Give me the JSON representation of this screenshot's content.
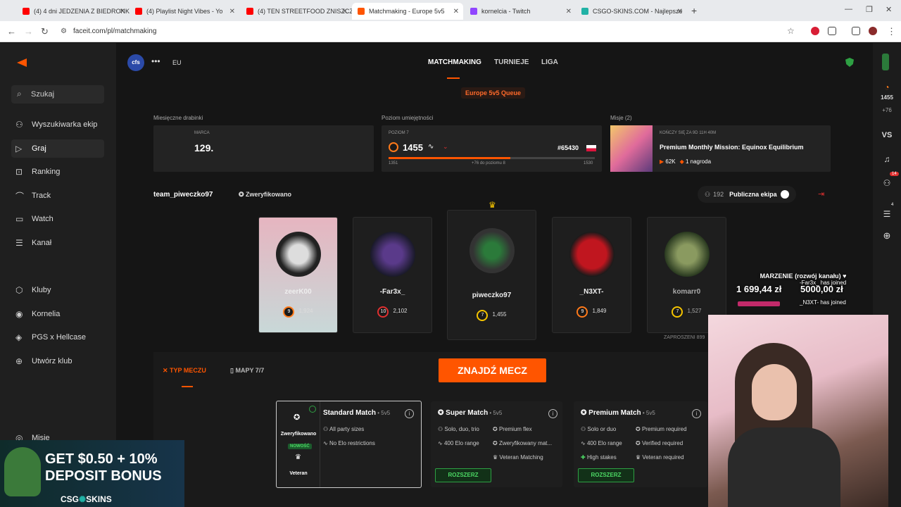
{
  "browser": {
    "tabs": [
      {
        "title": "(4) 4 dni JEDZENIA Z BIEDRONK",
        "color": "#ff0000"
      },
      {
        "title": "(4) Playlist Night Vibes - Yo",
        "color": "#ff0000"
      },
      {
        "title": "(4) TEN STREETFOOD ZNISZCZ",
        "color": "#ff0000"
      },
      {
        "title": "Matchmaking - Europe 5v5",
        "color": "#ff5500"
      },
      {
        "title": "kornelcia - Twitch",
        "color": "#9146ff"
      },
      {
        "title": "CSGO-SKINS.COM - Najlepsze",
        "color": "#21b2a6"
      }
    ],
    "url": "faceit.com/pl/matchmaking"
  },
  "sidebar": {
    "search_label": "Szukaj",
    "items": [
      {
        "label": "Wyszukiwarka ekip",
        "icon": "users-search-icon"
      },
      {
        "label": "Graj",
        "icon": "play-icon"
      },
      {
        "label": "Ranking",
        "icon": "ranking-icon"
      },
      {
        "label": "Track",
        "icon": "track-icon"
      },
      {
        "label": "Watch",
        "icon": "watch-icon"
      },
      {
        "label": "Kanał",
        "icon": "channel-icon"
      },
      {
        "label": "Kluby",
        "icon": "clubs-icon"
      },
      {
        "label": "Kornelia",
        "icon": "club-icon"
      },
      {
        "label": "PGS x Hellcase",
        "icon": "club-icon"
      },
      {
        "label": "Utwórz klub",
        "icon": "plus-icon"
      },
      {
        "label": "Misje",
        "icon": "missions-icon"
      }
    ]
  },
  "header": {
    "game_badge": "cfs",
    "region": "EU",
    "nav": [
      "MATCHMAKING",
      "TURNIEJE",
      "LIGA"
    ],
    "queue": "Europe 5v5 Queue"
  },
  "panels": {
    "ladder_label": "Miesięczne drabinki",
    "ladder_month": "MARCA",
    "ladder_pos": "129.",
    "skill_label": "Poziom umiejętności",
    "skill_level": "POZIOM 7",
    "skill_elo": "1455",
    "skill_rank": "#65430",
    "skill_min": "1351",
    "skill_next": "+76 do poziomu 8",
    "skill_max": "1530",
    "skill_progress": 0.59,
    "missions_label": "Misje (2)",
    "mission_timer": "KOŃCZY SIĘ ZA 9D 11H 40M",
    "mission_title": "Premium Monthly Mission: Equinox Equilibrium",
    "mission_reward": "62K",
    "mission_prize": "1 nagroda"
  },
  "team": {
    "name": "team_piweczko97",
    "verified": "Zweryfikowano",
    "count": "192",
    "public": "Publiczna ekipa",
    "invited": "ZAPROSZENI 899"
  },
  "players": [
    {
      "name": "zeerK00",
      "level": "9",
      "elo": "1,924"
    },
    {
      "name": "-Far3x_",
      "level": "10",
      "elo": "2,102"
    },
    {
      "name": "piweczko97",
      "level": "7",
      "elo": "1,455"
    },
    {
      "name": "_N3XT-",
      "level": "9",
      "elo": "1,849"
    },
    {
      "name": "komarr0",
      "level": "7",
      "elo": "1,527"
    }
  ],
  "match": {
    "tab_type": "TYP MECZU",
    "tab_maps": "MAPY 7/7",
    "find": "ZNAJDŹ MECZ",
    "verified_label": "Zweryfikowano",
    "new_badge": "NOWOŚĆ",
    "veteran_label": "Veteran",
    "modes": [
      {
        "title": "Standard Match",
        "fmt": "5v5",
        "features": [
          "All party sizes",
          "No Elo restrictions"
        ]
      },
      {
        "title": "Super Match",
        "fmt": "5v5",
        "features": [
          "Solo, duo, trio",
          "400 Elo range",
          "Premium flex",
          "Zweryfikowany mat...",
          "Veteran Matching"
        ],
        "button": "ROZSZERZ"
      },
      {
        "title": "Premium Match",
        "fmt": "5v5",
        "features": [
          "Solo or duo",
          "400 Elo range",
          "High stakes",
          "Premium required",
          "Verified required",
          "Veteran required"
        ],
        "button": "ROZSZERZ"
      }
    ]
  },
  "rightbar": {
    "elo": "1455",
    "delta": "+76",
    "vs": "VS",
    "notif": "14",
    "count": "4"
  },
  "stream_overlay": {
    "goal_title": "MARZENIE (rozwój kanału) ♥",
    "goal_current": "1 699,44 zł",
    "goal_target": "5000,00 zł",
    "events": [
      "-Far3x_ has joined",
      "_N3XT- has joined"
    ]
  },
  "ad": {
    "line1": "GET $0.50 + 10%",
    "line2": "DEPOSIT BONUS",
    "brand": "CSG",
    "brand2": "SKINS"
  }
}
